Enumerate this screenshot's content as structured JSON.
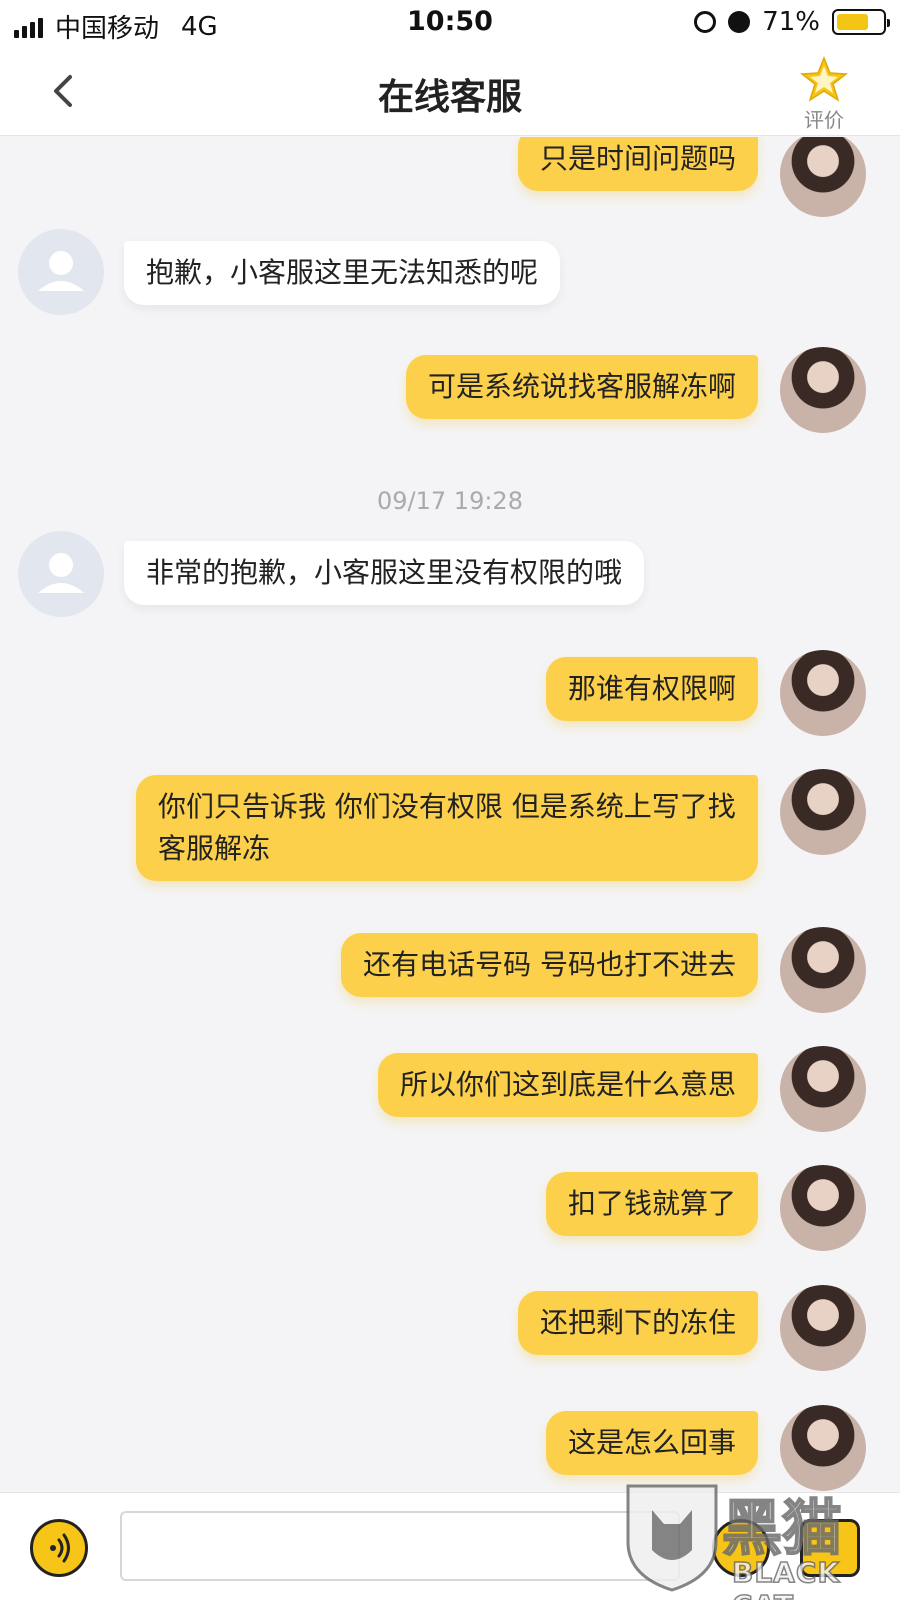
{
  "status_bar": {
    "carrier": "中国移动",
    "network": "4G",
    "time": "10:50",
    "battery": "71%",
    "battery_level": 0.71
  },
  "header": {
    "title": "在线客服",
    "rate_label": "评价"
  },
  "messages": [
    {
      "side": "out",
      "text": "只是时间问题吗"
    },
    {
      "side": "in",
      "text": "抱歉，小客服这里无法知悉的呢"
    },
    {
      "side": "out",
      "text": "可是系统说找客服解冻啊"
    },
    {
      "side": "in",
      "text": "非常的抱歉，小客服这里没有权限的哦"
    },
    {
      "side": "out",
      "text": "那谁有权限啊"
    },
    {
      "side": "out",
      "text": "你们只告诉我 你们没有权限 但是系统上写了找客服解冻"
    },
    {
      "side": "out",
      "text": "还有电话号码 号码也打不进去"
    },
    {
      "side": "out",
      "text": "所以你们这到底是什么意思"
    },
    {
      "side": "out",
      "text": "扣了钱就算了"
    },
    {
      "side": "out",
      "text": "还把剩下的冻住"
    },
    {
      "side": "out",
      "text": "这是怎么回事"
    }
  ],
  "timestamp": "09/17 19:28",
  "watermark": {
    "title": "黑猫",
    "subtitle": "BLACK CAT"
  },
  "colors": {
    "accent": "#fcd04a",
    "background": "#f4f4f6"
  }
}
